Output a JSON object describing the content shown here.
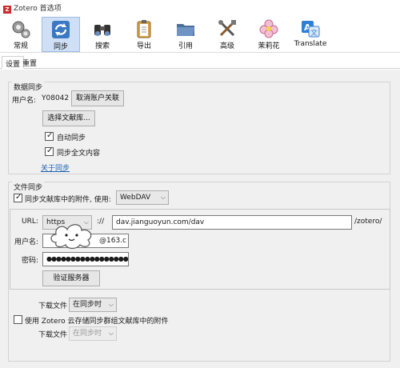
{
  "window": {
    "title": "Zotero 首选项"
  },
  "toolbar": [
    {
      "label": "常规",
      "icon": "gears-icon"
    },
    {
      "label": "同步",
      "icon": "sync-icon"
    },
    {
      "label": "搜索",
      "icon": "binoculars-icon"
    },
    {
      "label": "导出",
      "icon": "clipboard-icon"
    },
    {
      "label": "引用",
      "icon": "folder-icon"
    },
    {
      "label": "高级",
      "icon": "tools-icon"
    },
    {
      "label": "茉莉花",
      "icon": "jasmine-icon"
    },
    {
      "label": "Translate",
      "icon": "translate-icon"
    }
  ],
  "subtabs": [
    "设置",
    "重置"
  ],
  "data_sync": {
    "title": "数据同步",
    "username_label": "用户名:",
    "username_value": "Y08042",
    "unlink_button": "取消账户关联",
    "choose_library_button": "选择文献库...",
    "auto_sync_label": "自动同步",
    "fulltext_sync_label": "同步全文内容",
    "about_link": "关于同步"
  },
  "file_sync": {
    "title": "文件同步",
    "sync_attachments_label": "同步文献库中的附件, 使用:",
    "method_value": "WebDAV",
    "url_label": "URL:",
    "protocol_value": "https",
    "scheme_sep": "://",
    "url_value": "dav.jianguoyun.com/dav",
    "url_suffix": "/zotero/",
    "username_label": "用户名:",
    "username_value": "@163.c",
    "password_label": "密码:",
    "password_value": "●●●●●●●●●●●●●●●●●",
    "verify_button": "验证服务器",
    "download_label_1": "下载文件",
    "download_value_1": "在同步时",
    "group_storage_label": "使用 Zotero 云存储同步群组文献库中的附件",
    "download_label_2": "下载文件",
    "download_value_2": "在同步时"
  },
  "colors": {
    "active_tab": "#cfe0f6",
    "link": "#1a5fb4",
    "panel_bg": "#f0f0f0"
  }
}
